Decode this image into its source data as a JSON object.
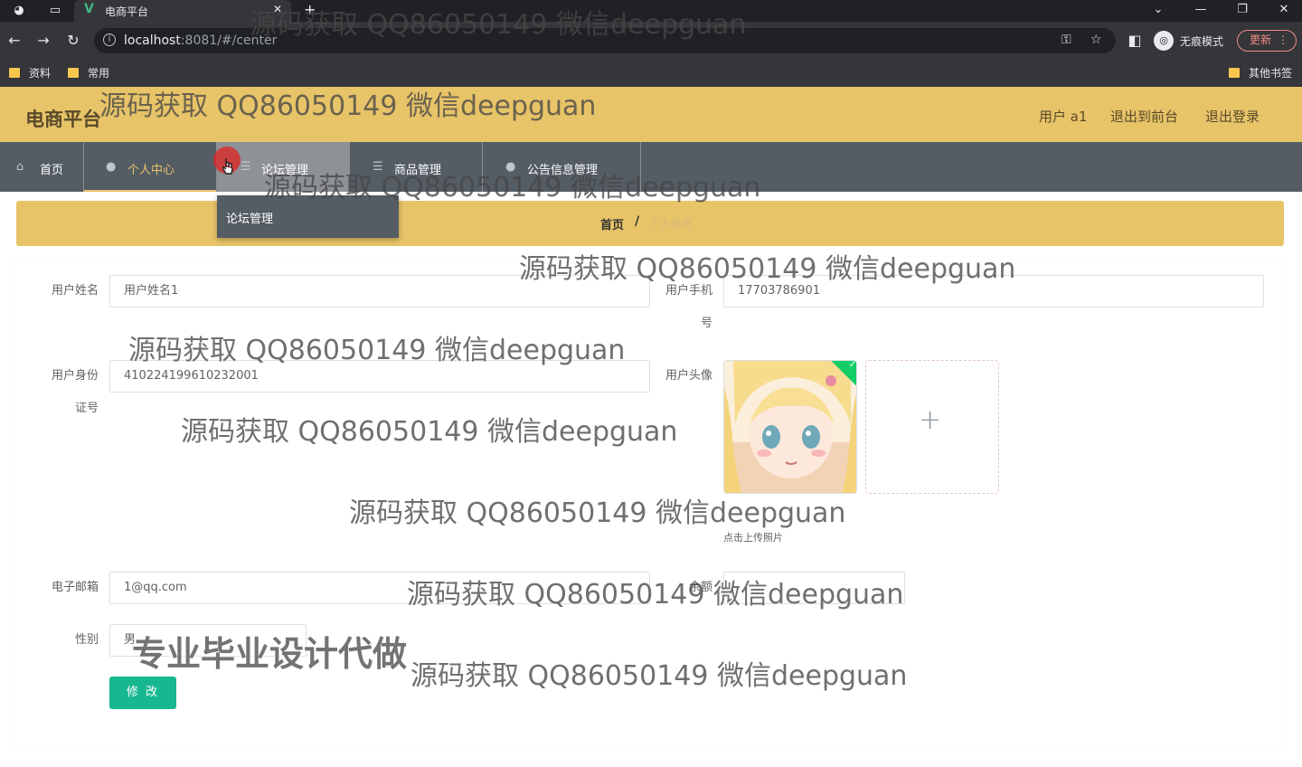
{
  "browser": {
    "tab_title": "电商平台",
    "url_host": "localhost",
    "url_rest": ":8081/#/center",
    "incognito_label": "无痕模式",
    "update_label": "更新",
    "bookmarks": [
      "资料",
      "常用"
    ],
    "other_bookmarks": "其他书签"
  },
  "header": {
    "brand": "电商平台",
    "user": "用户 a1",
    "to_front": "退出到前台",
    "logout": "退出登录"
  },
  "nav": {
    "items": [
      {
        "label": "首页",
        "icon": "home-icon"
      },
      {
        "label": "个人中心",
        "icon": "user-icon"
      },
      {
        "label": "论坛管理",
        "icon": "menu-icon"
      },
      {
        "label": "商品管理",
        "icon": "menu-icon"
      },
      {
        "label": "公告信息管理",
        "icon": "user-icon"
      }
    ],
    "dropdown_item": "论坛管理"
  },
  "breadcrumb": {
    "home": "首页",
    "separator": "/",
    "current": "个人信息"
  },
  "form": {
    "name_label": "用户姓名",
    "name_value": "用户姓名1",
    "phone_label_1": "用户手机",
    "phone_label_2": "号",
    "phone_value": "17703786901",
    "idcard_label_1": "用户身份",
    "idcard_label_2": "证号",
    "idcard_value": "410224199610232001",
    "avatar_label": "用户头像",
    "upload_tip": "点击上传照片",
    "email_label": "电子邮箱",
    "email_value": "1@qq.com",
    "balance_label": "余额",
    "gender_label": "性别",
    "gender_value": "男",
    "submit_label": "修 改"
  },
  "watermark": {
    "text": "源码获取 QQ86050149 微信deepguan",
    "big_text": "专业毕业设计代做"
  },
  "colors": {
    "header_bg": "#e8c468",
    "nav_bg": "#545c64",
    "nav_active": "#e8c468",
    "submit_bg": "#17b890"
  }
}
